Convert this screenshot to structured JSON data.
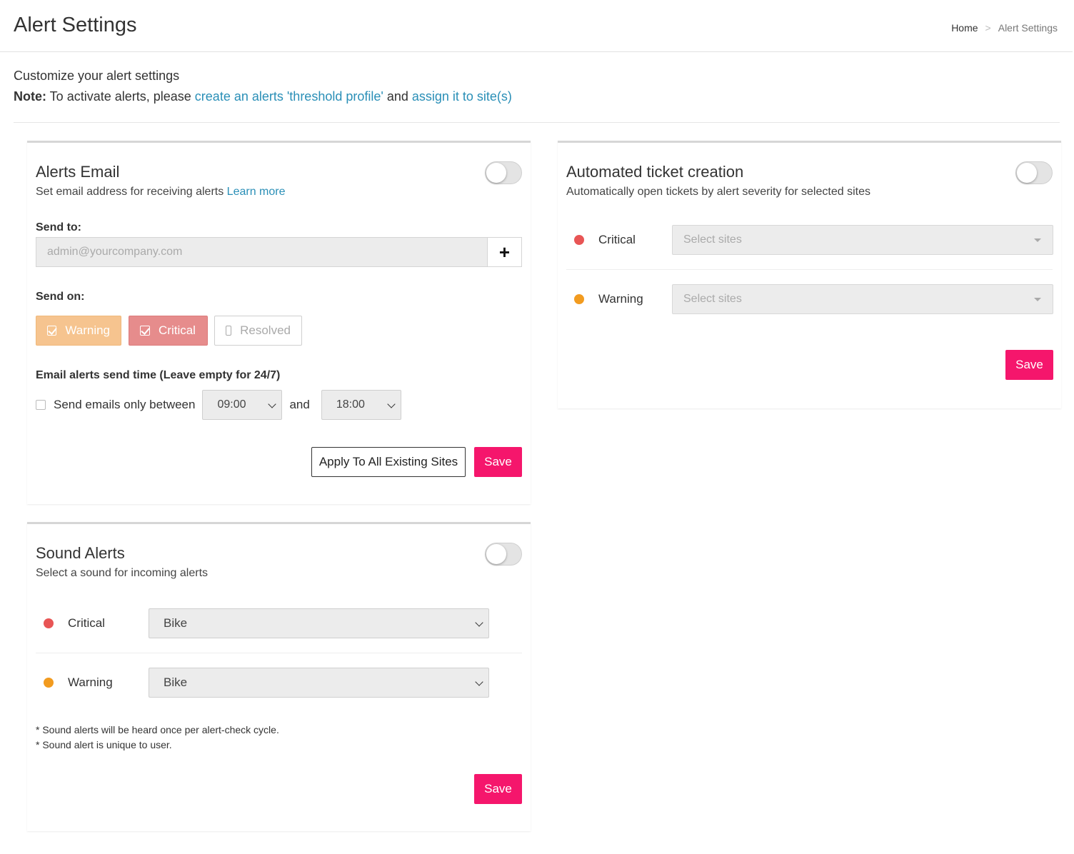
{
  "header": {
    "title": "Alert Settings",
    "breadcrumb": {
      "home": "Home",
      "separator": ">",
      "current": "Alert Settings"
    }
  },
  "intro": {
    "line1": "Customize your alert settings",
    "note_label": "Note:",
    "note_text": " To activate alerts, please ",
    "link1": "create an alerts 'threshold profile'",
    "and": " and ",
    "link2": "assign it to site(s)"
  },
  "alerts_email": {
    "title": "Alerts Email",
    "subtitle": "Set email address for receiving alerts ",
    "learn_more": "Learn more",
    "enabled": false,
    "send_to_label": "Send to:",
    "email_placeholder": "admin@yourcompany.com",
    "email_value": "",
    "add_icon": "+",
    "send_on_label": "Send on:",
    "severity_options": [
      {
        "label": "Warning",
        "checked": true,
        "color": "#f6c48f"
      },
      {
        "label": "Critical",
        "checked": true,
        "color": "#e68c8c"
      },
      {
        "label": "Resolved",
        "checked": false,
        "color": "#ffffff"
      }
    ],
    "send_time_label": "Email alerts send time (Leave empty for 24/7)",
    "only_between_label": "Send emails only between",
    "only_between_checked": false,
    "start_time": "09:00",
    "and_label": "and",
    "end_time": "18:00",
    "apply_all_label": "Apply To All Existing Sites",
    "save_label": "Save"
  },
  "sound_alerts": {
    "title": "Sound Alerts",
    "subtitle": "Select a sound for incoming alerts",
    "enabled": false,
    "rows": [
      {
        "severity": "Critical",
        "color": "#e85555",
        "sound": "Bike"
      },
      {
        "severity": "Warning",
        "color": "#f29b1f",
        "sound": "Bike"
      }
    ],
    "notes": [
      "* Sound alerts will be heard once per alert-check cycle.",
      "* Sound alert is unique to user."
    ],
    "save_label": "Save"
  },
  "ticket_creation": {
    "title": "Automated ticket creation",
    "subtitle": "Automatically open tickets by alert severity for selected sites",
    "enabled": false,
    "rows": [
      {
        "severity": "Critical",
        "color": "#e85555",
        "placeholder": "Select sites"
      },
      {
        "severity": "Warning",
        "color": "#f29b1f",
        "placeholder": "Select sites"
      }
    ],
    "save_label": "Save"
  },
  "colors": {
    "accent": "#f5166c",
    "link": "#2a8fb7",
    "critical": "#e85555",
    "warning": "#f29b1f"
  }
}
